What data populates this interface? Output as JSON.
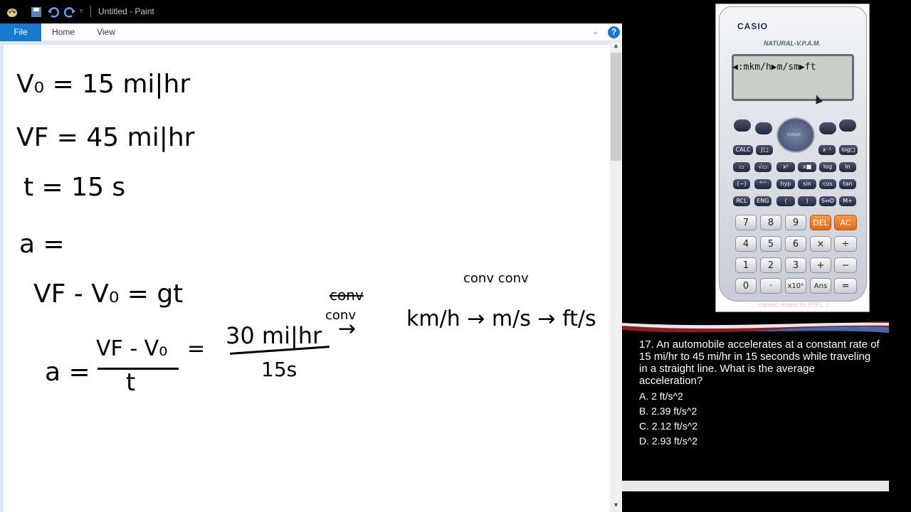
{
  "window": {
    "title": "Untitled - Paint"
  },
  "ribbon": {
    "tabs": [
      {
        "label": "File"
      },
      {
        "label": "Home"
      },
      {
        "label": "View"
      }
    ],
    "help_label": "?"
  },
  "canvas": {
    "handwriting": {
      "v0": "V₀ = 15 mi|hr",
      "vf": "VF = 45 mi|hr",
      "t": "t = 15 s",
      "a": "a =",
      "eq1": "VF - V₀ = gt",
      "eq2_lhs": "a =",
      "eq2_num": "VF - V₀",
      "eq2_den": "t",
      "eq2_eq": "=",
      "frac_num": "30 mi|hr",
      "frac_den": "15s",
      "scribble1": "conv",
      "conv_word": "conv",
      "conv_arrow": "→",
      "conv_chain": "km/h → m/s → ft/s",
      "top_words": "conv      conv"
    }
  },
  "calculator": {
    "brand": "CASIO",
    "model": "NATURAL-V.P.A.M.",
    "display": "◀:mkm/h▶m/sm▶ft",
    "replay_label": "REPLAY",
    "rows": [
      [
        "CALC",
        "∫□",
        "x⁻¹",
        "log□"
      ],
      [
        "▭",
        "√▭",
        "x²",
        "x■",
        "log",
        "ln"
      ],
      [
        "(−)",
        "°'''",
        "hyp",
        "sin",
        "cos",
        "tan"
      ],
      [
        "RCL",
        "ENG",
        "(",
        ")",
        "S⇔D",
        "M+"
      ]
    ],
    "num_rows": [
      [
        "7",
        "8",
        "9",
        "DEL",
        "AC"
      ],
      [
        "4",
        "5",
        "6",
        "×",
        "÷"
      ],
      [
        "1",
        "2",
        "3",
        "+",
        "−"
      ],
      [
        "0",
        "·",
        "x10ˣ",
        "Ans",
        "="
      ]
    ],
    "watermark": "cracked version for HTKC :)"
  },
  "question": {
    "text": "17. An automobile accelerates at a constant rate of 15 mi/hr to 45 mi/hr in 15 seconds while traveling in a straight line. What is the average acceleration?",
    "choices": [
      "A.  2 ft/s^2",
      "B. 2.39 ft/s^2",
      "C. 2.12 ft/s^2",
      "D. 2.93 ft/s^2"
    ]
  }
}
